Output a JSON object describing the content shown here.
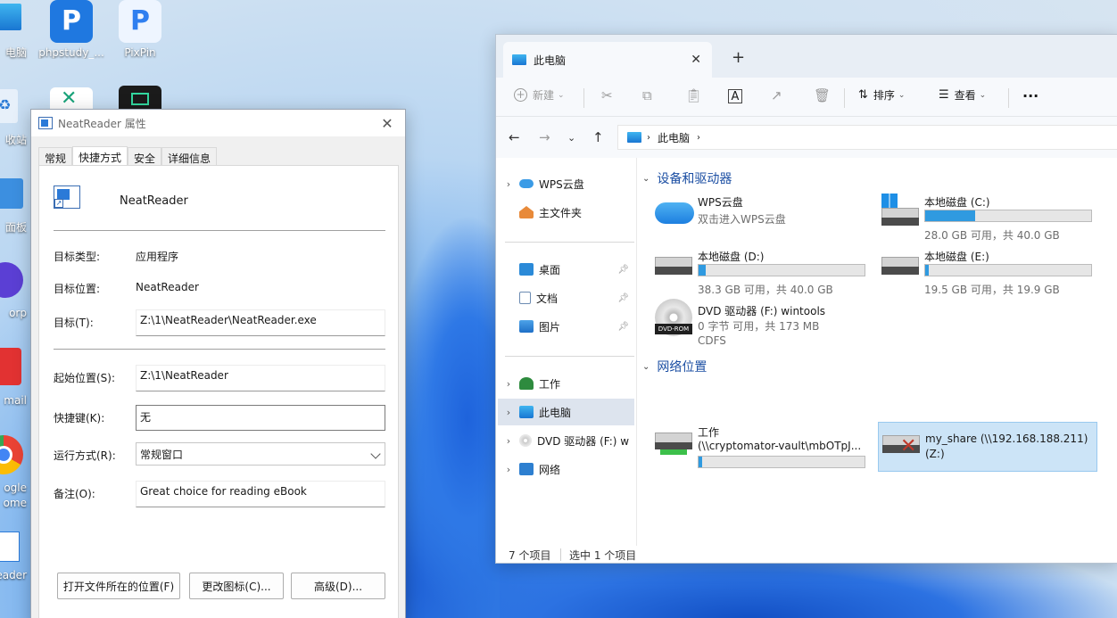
{
  "desktop": {
    "icons": [
      {
        "label": "phpstudy_...",
        "color": "#1f78e0",
        "glyph": "P"
      },
      {
        "label": "PixPin",
        "color": "#e8f1ff",
        "glyph": "P"
      }
    ],
    "left_labels": [
      "电脑",
      "收站",
      "面板",
      "orp",
      "mail",
      "ogle",
      "ome",
      "eader"
    ]
  },
  "props": {
    "title": "NeatReader 属性",
    "tabs": [
      "常规",
      "快捷方式",
      "安全",
      "详细信息"
    ],
    "active_tab": "快捷方式",
    "app_name": "NeatReader",
    "target_type_label": "目标类型:",
    "target_type_value": "应用程序",
    "target_location_label": "目标位置:",
    "target_location_value": "NeatReader",
    "target_label": "目标(T):",
    "target_value": "Z:\\1\\NeatReader\\NeatReader.exe",
    "start_in_label": "起始位置(S):",
    "start_in_value": "Z:\\1\\NeatReader",
    "shortcut_key_label": "快捷键(K):",
    "shortcut_key_value": "无",
    "run_label": "运行方式(R):",
    "run_value": "常规窗口",
    "comment_label": "备注(O):",
    "comment_value": "Great choice for reading eBook",
    "btn_open_location": "打开文件所在的位置(F)",
    "btn_change_icon": "更改图标(C)...",
    "btn_advanced": "高级(D)..."
  },
  "explorer": {
    "tab_title": "此电脑",
    "toolbar": {
      "new": "新建",
      "sort": "排序",
      "view": "查看",
      "more": "..."
    },
    "address": "此电脑",
    "nav": [
      {
        "label": "WPS云盘",
        "chevron": true
      },
      {
        "label": "主文件夹",
        "chevron": false
      },
      {
        "label": "桌面",
        "pinned": true
      },
      {
        "label": "文档",
        "pinned": true
      },
      {
        "label": "图片",
        "pinned": true
      },
      {
        "label": "工作",
        "chevron": true
      },
      {
        "label": "此电脑",
        "chevron": true,
        "selected": true
      },
      {
        "label": "DVD 驱动器 (F:) w",
        "chevron": true
      },
      {
        "label": "网络",
        "chevron": true
      }
    ],
    "section_devices": "设备和驱动器",
    "section_network": "网络位置",
    "drives": [
      {
        "name": "WPS云盘",
        "sub": "双击进入WPS云盘"
      },
      {
        "name": "本地磁盘 (C:)",
        "sub": "28.0 GB 可用，共 40.0 GB",
        "used_fraction": 0.3
      },
      {
        "name": "本地磁盘 (D:)",
        "sub": "38.3 GB 可用，共 40.0 GB",
        "used_fraction": 0.043
      },
      {
        "name": "本地磁盘 (E:)",
        "sub": "19.5 GB 可用，共 19.9 GB",
        "used_fraction": 0.02
      },
      {
        "name": "DVD 驱动器 (F:) wintools",
        "sub": "0 字节 可用，共 173 MB",
        "sub2": "CDFS",
        "icon_text": "DVD-ROM"
      }
    ],
    "network": [
      {
        "name": "工作",
        "sub": "(\\\\cryptomator-vault\\mbOTpJ...",
        "used_fraction": 0.02
      },
      {
        "name": "my_share (\\\\192.168.188.211)",
        "sub": "(Z:)"
      }
    ],
    "status_items": "7 个项目",
    "status_selected": "选中 1 个项目"
  }
}
